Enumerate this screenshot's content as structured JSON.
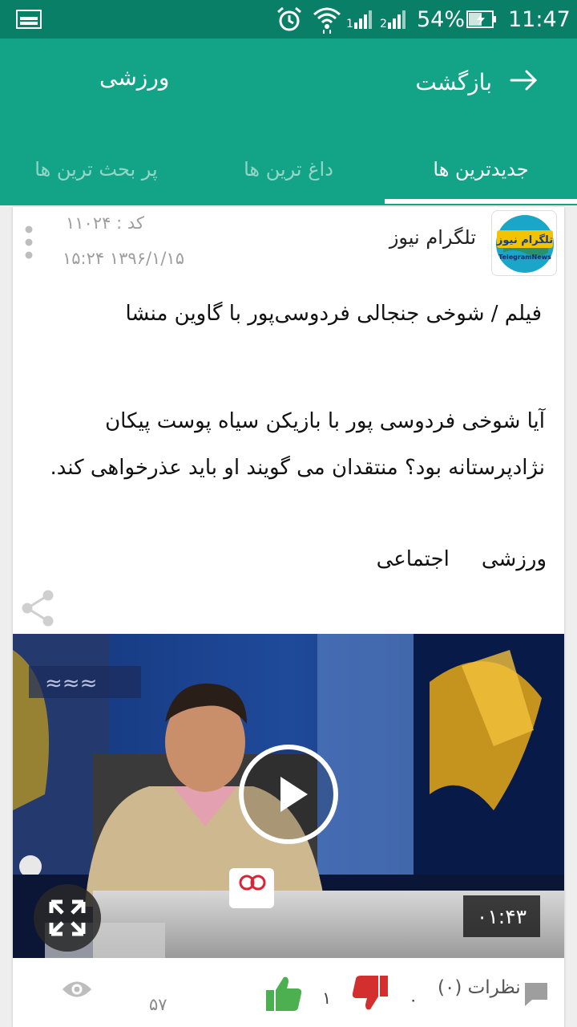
{
  "status_bar": {
    "battery": "54%",
    "time": "11:47",
    "icons": [
      "gallery-icon",
      "alarm-icon",
      "wifi-icon",
      "signal1-icon",
      "signal2-icon",
      "battery-charging-icon"
    ]
  },
  "app_bar": {
    "back_label": "بازگشت",
    "title": "ورزشی",
    "colors": {
      "primary": "#13a386",
      "status": "#0a7f67"
    }
  },
  "tabs": [
    {
      "label": "جدیدترین ها",
      "active": true
    },
    {
      "label": "داغ ترین ها",
      "active": false
    },
    {
      "label": "پر بحث ترین ها",
      "active": false
    }
  ],
  "post": {
    "avatar_text": "تلگرام نیوز",
    "avatar_subtext": "TelegramNews",
    "source": "تلگرام نیوز",
    "code": "کد : ۱۱۰۲۴",
    "date": "۱۵:۲۴ ۱۳۹۶/۱/۱۵",
    "headline": "فیلم / شوخی جنجالی فردوسی‌پور با گاوین منشا",
    "body_line1": "آیا شوخی فردوسی پور با بازیکن سیاه پوست پیکان",
    "body_line2": "نژادپرستانه بود؟ منتقدان می گویند او باید عذرخواهی کند.",
    "tags": [
      "ورزشی",
      "اجتماعی"
    ],
    "video": {
      "duration": "۰۱:۴۳"
    },
    "stats": {
      "views": "۵۷",
      "likes": "۱",
      "dislikes": "۰",
      "comments": "نظرات (۰)"
    }
  }
}
